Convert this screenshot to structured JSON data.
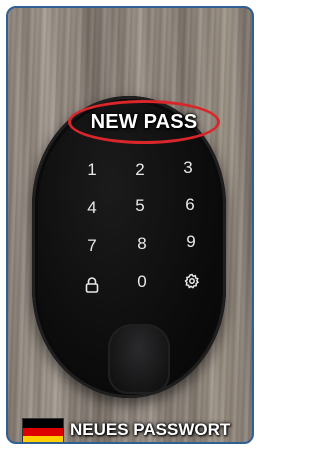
{
  "callout": {
    "text": "NEW PASS",
    "color": "#d8262b"
  },
  "keypad": {
    "keys": [
      "1",
      "2",
      "3",
      "4",
      "5",
      "6",
      "7",
      "8",
      "9",
      "0"
    ],
    "lock_icon": "lock-icon",
    "settings_icon": "gear-icon"
  },
  "fingerprint_sensor": "fingerprint-sensor",
  "footer": {
    "flag_colors": [
      "#000000",
      "#dd0000",
      "#ffce00"
    ],
    "text": "NEUES PASSWORT"
  },
  "frame_color": "#2f5f93"
}
